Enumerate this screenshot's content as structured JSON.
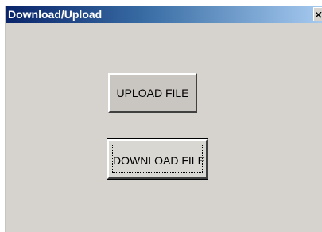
{
  "window": {
    "title": "Download/Upload",
    "close_glyph": "×"
  },
  "buttons": {
    "upload_label": "UPLOAD FILE",
    "download_label": "DOWNLOAD FILE"
  },
  "colors": {
    "titlebar_start": "#0a246a",
    "titlebar_end": "#a6caf0",
    "dialog_face": "#d6d3ce"
  },
  "icons": {
    "close": "close-icon"
  }
}
